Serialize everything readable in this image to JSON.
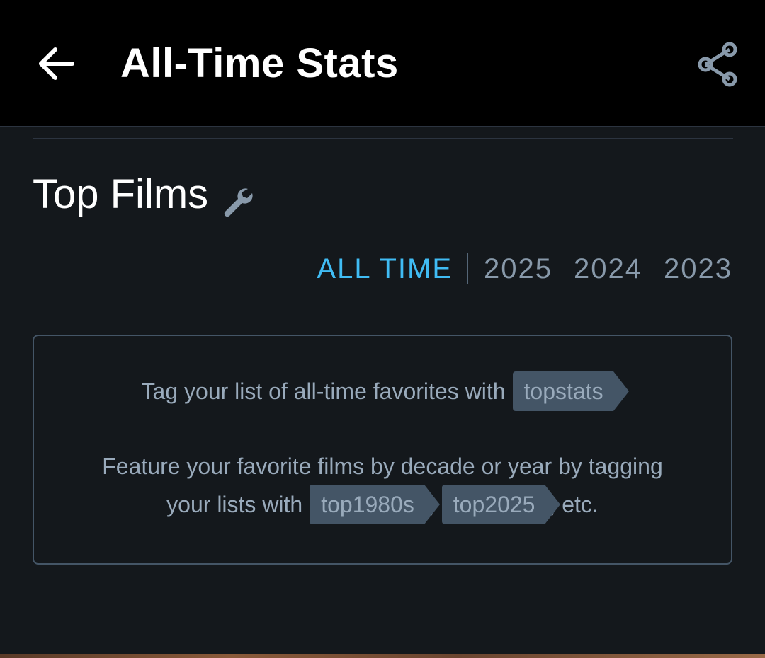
{
  "appbar": {
    "title": "All-Time Stats",
    "back_icon": "arrow-left-icon",
    "share_icon": "share-icon"
  },
  "section": {
    "title": "Top Films",
    "settings_icon": "wrench-icon"
  },
  "tabs": [
    {
      "label": "ALL TIME",
      "active": true
    },
    {
      "label": "2025",
      "active": false
    },
    {
      "label": "2024",
      "active": false
    },
    {
      "label": "2023",
      "active": false
    }
  ],
  "info": {
    "line1_text": "Tag your list of all-time favorites with",
    "line1_tag": "topstats",
    "line1_end": ".",
    "line2_text": "Feature your favorite films by decade or year by tagging",
    "line3_text": "your lists with",
    "line3_tag1": "top1980s",
    "line3_sep": ",",
    "line3_tag2": "top2025",
    "line3_end": ", etc."
  },
  "colors": {
    "background": "#14181c",
    "accent": "#40bcf4",
    "muted": "#8899aa",
    "tag_bg": "#445566"
  }
}
